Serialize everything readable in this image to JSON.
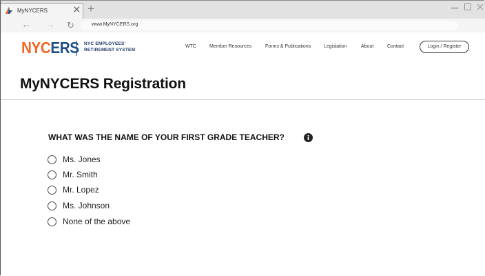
{
  "browser": {
    "tab_title": "MyNYCERS",
    "url": "www.MyNYCERS.org"
  },
  "site": {
    "logo_primary": "NYC",
    "logo_secondary": "ERS",
    "logo_tagline_line1": "NYC EMPLOYEES'",
    "logo_tagline_line2": "RETIREMENT SYSTEM",
    "nav": [
      "WTC",
      "Member Resources",
      "Forms & Publications",
      "Legislation",
      "About",
      "Contact"
    ],
    "login_label": "Login / Register",
    "colors": {
      "brand_orange": "#f26722",
      "brand_blue": "#1f4f8b"
    }
  },
  "page": {
    "title": "MyNYCERS Registration"
  },
  "question": {
    "text": "WHAT WAS THE NAME OF YOUR FIRST GRADE TEACHER?",
    "options": [
      "Ms. Jones",
      "Mr. Smith",
      "Mr. Lopez",
      "Ms. Johnson",
      "None of the above"
    ]
  }
}
